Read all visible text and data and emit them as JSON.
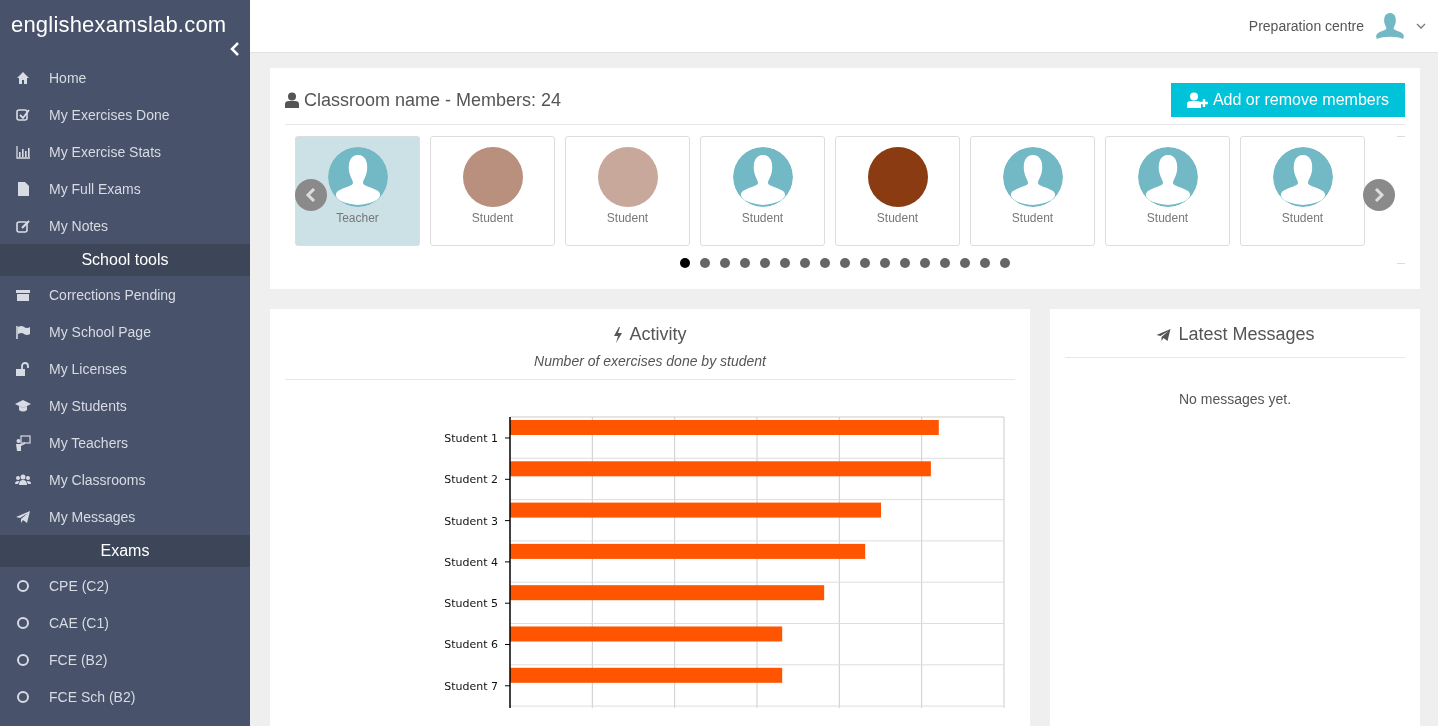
{
  "sidebar": {
    "logo": "englishexamslab.com",
    "sections": [
      {
        "items": [
          {
            "label": "Home"
          },
          {
            "label": "My Exercises Done"
          },
          {
            "label": "My Exercise Stats"
          },
          {
            "label": "My Full Exams"
          },
          {
            "label": "My Notes"
          }
        ]
      },
      {
        "title": "School tools",
        "items": [
          {
            "label": "Corrections Pending"
          },
          {
            "label": "My School Page"
          },
          {
            "label": "My Licenses"
          },
          {
            "label": "My Students"
          },
          {
            "label": "My Teachers"
          },
          {
            "label": "My Classrooms"
          },
          {
            "label": "My Messages"
          }
        ]
      },
      {
        "title": "Exams",
        "items": [
          {
            "label": "CPE (C2)"
          },
          {
            "label": "CAE (C1)"
          },
          {
            "label": "FCE (B2)"
          },
          {
            "label": "FCE Sch (B2)"
          }
        ]
      }
    ]
  },
  "topbar": {
    "user": "Preparation centre"
  },
  "classroom": {
    "title": "Classroom name - Members: 24",
    "button": "Add or remove members",
    "members": [
      {
        "role": "Teacher",
        "kind": "default",
        "selected": true
      },
      {
        "role": "Student",
        "kind": "photo",
        "selected": false
      },
      {
        "role": "Student",
        "kind": "photo",
        "selected": false
      },
      {
        "role": "Student",
        "kind": "default",
        "selected": false
      },
      {
        "role": "Student",
        "kind": "photo",
        "selected": false
      },
      {
        "role": "Student",
        "kind": "default",
        "selected": false
      },
      {
        "role": "Student",
        "kind": "default",
        "selected": false
      },
      {
        "role": "Student",
        "kind": "default",
        "selected": false
      }
    ],
    "pages": [
      {
        "selected": true
      },
      {
        "selected": false
      },
      {
        "selected": false
      },
      {
        "selected": false
      },
      {
        "selected": false
      },
      {
        "selected": false
      },
      {
        "selected": false
      },
      {
        "selected": false
      },
      {
        "selected": false
      },
      {
        "selected": false
      },
      {
        "selected": false
      },
      {
        "selected": false
      },
      {
        "selected": false
      },
      {
        "selected": false
      },
      {
        "selected": false
      },
      {
        "selected": false
      },
      {
        "selected": false
      }
    ]
  },
  "activity": {
    "title": "Activity",
    "subtitle": "Number of exercises done by student",
    "students": [
      "Student 1",
      "Student 2",
      "Student 3",
      "Student 4",
      "Student 5",
      "Student 6",
      "Student 7"
    ]
  },
  "messages": {
    "title": "Latest Messages",
    "empty": "No messages yet."
  }
}
